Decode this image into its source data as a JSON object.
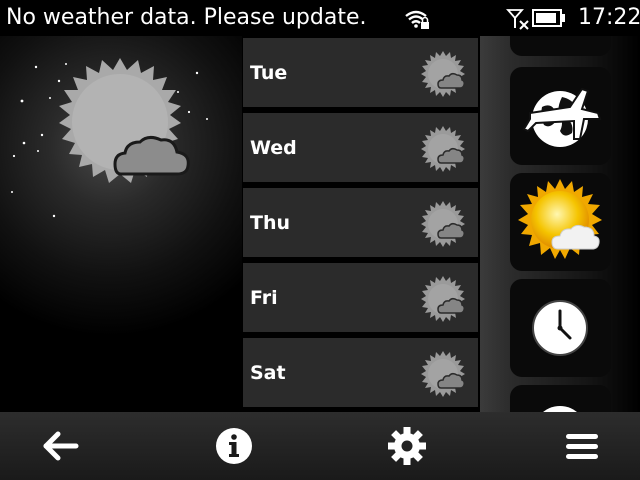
{
  "status_bar": {
    "message": "No weather data. Please update.",
    "time": "17:22",
    "wifi_icon": "wifi-locked-icon",
    "signal_icon": "no-signal-icon",
    "battery_icon": "battery-icon"
  },
  "current_weather": {
    "icon": "sun-cloud-icon"
  },
  "forecast": {
    "days": [
      {
        "label": "Tue",
        "icon": "sun-cloud-icon"
      },
      {
        "label": "Wed",
        "icon": "sun-cloud-icon"
      },
      {
        "label": "Thu",
        "icon": "sun-cloud-icon"
      },
      {
        "label": "Fri",
        "icon": "sun-cloud-icon"
      },
      {
        "label": "Sat",
        "icon": "sun-cloud-icon"
      }
    ]
  },
  "app_panel": {
    "apps": [
      "travel-globe-icon",
      "weather-icon",
      "clock-icon"
    ]
  },
  "toolbar": {
    "back_icon": "back-arrow-icon",
    "info_icon": "info-icon",
    "settings_icon": "gear-icon",
    "menu_icon": "menu-icon"
  },
  "colors": {
    "background": "#000000",
    "row_background": "#2b2b2b",
    "accent_sun": "#f5c400"
  }
}
